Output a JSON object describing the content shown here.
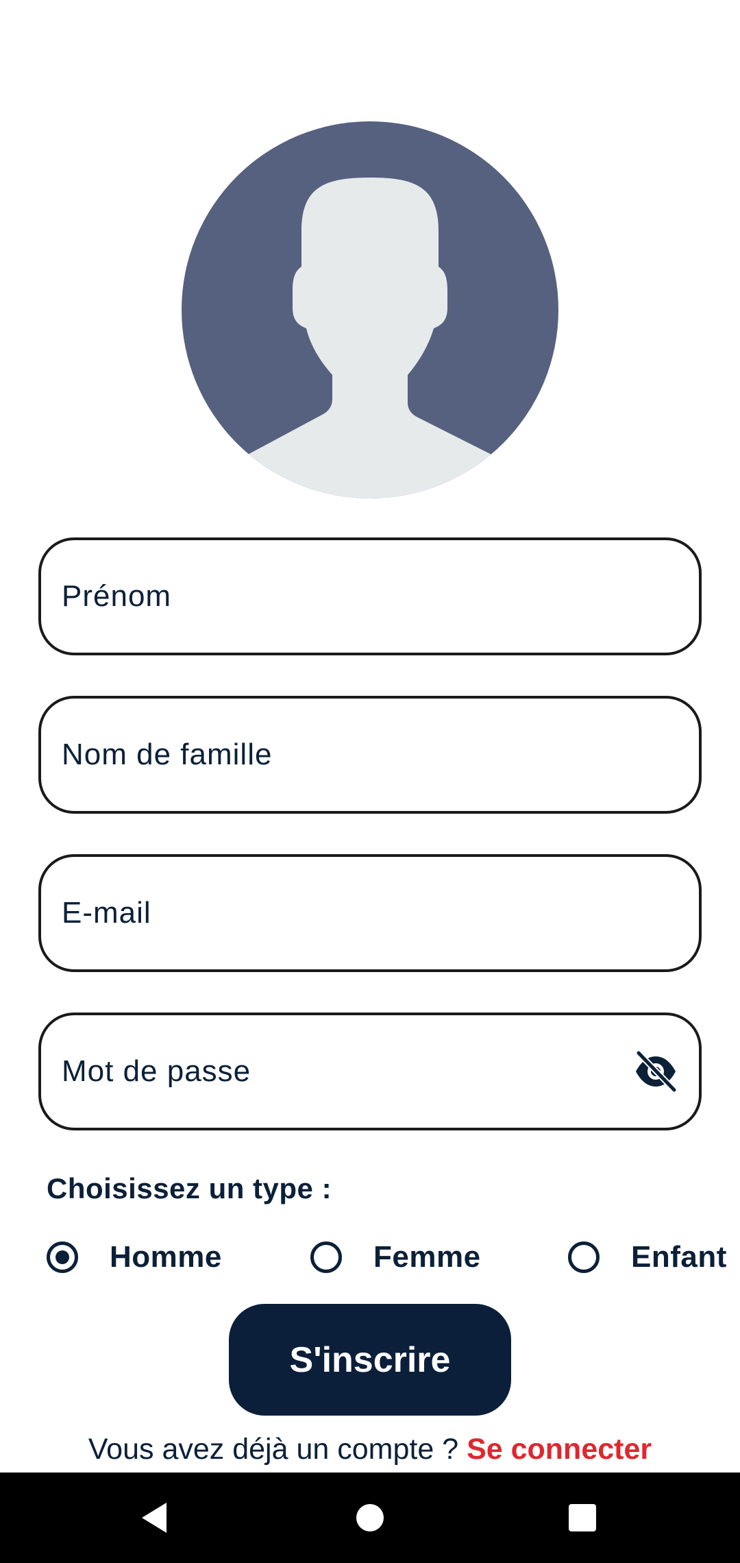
{
  "avatar": {
    "icon": "default-user-avatar-icon",
    "bg_color": "#56617f",
    "fg_color": "#e6eaeb"
  },
  "form": {
    "first_name": {
      "placeholder": "Prénom",
      "value": ""
    },
    "last_name": {
      "placeholder": "Nom de famille",
      "value": ""
    },
    "email": {
      "placeholder": "E-mail",
      "value": ""
    },
    "password": {
      "placeholder": "Mot de passe",
      "value": "",
      "toggle_icon": "eye-off-icon"
    }
  },
  "type_selector": {
    "label": "Choisissez un type :",
    "options": [
      {
        "label": "Homme",
        "selected": true
      },
      {
        "label": "Femme",
        "selected": false
      },
      {
        "label": "Enfant",
        "selected": false
      }
    ]
  },
  "submit": {
    "label": "S'inscrire"
  },
  "login_prompt": {
    "text": "Vous avez déjà un compte ? ",
    "link": "Se connecter"
  },
  "navigation": {
    "back": "back-icon",
    "home": "home-icon",
    "recents": "recents-icon"
  },
  "colors": {
    "primary": "#0b1f3a",
    "link": "#e0262e",
    "text": "#0c2038"
  }
}
